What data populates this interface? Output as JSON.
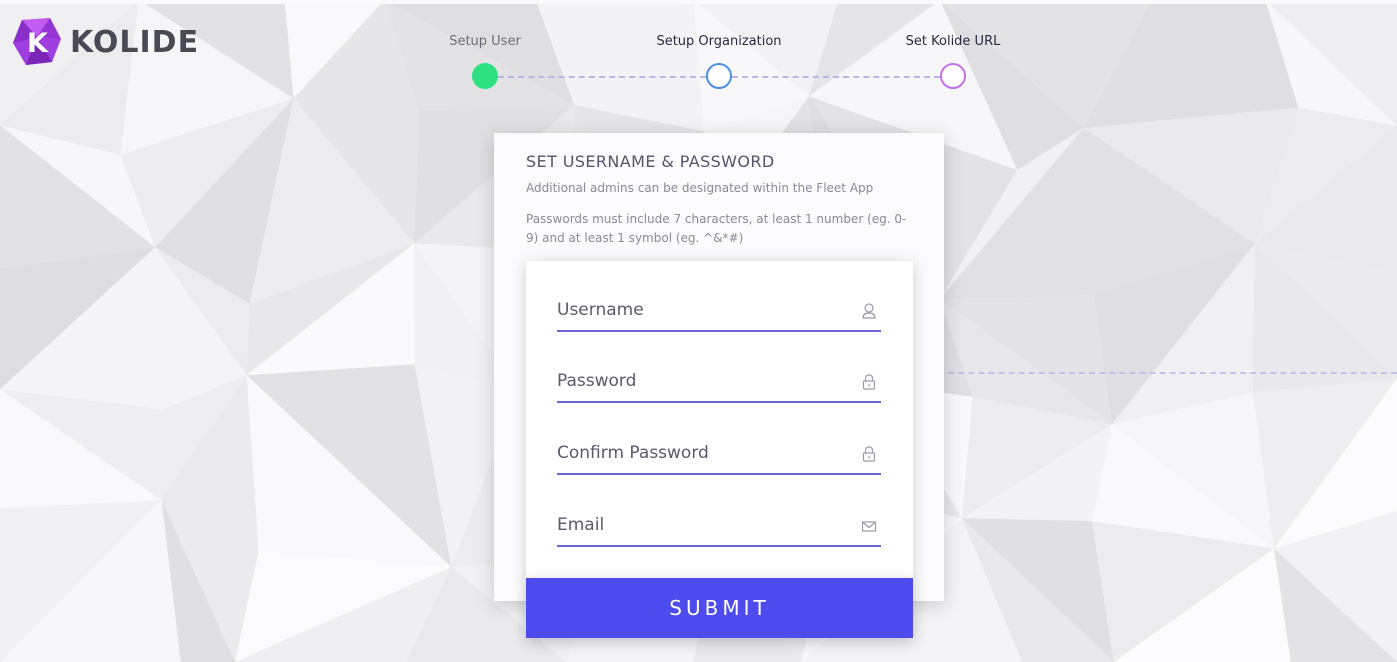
{
  "brand": {
    "name": "KOLIDE",
    "logo_letter": "K"
  },
  "steps": [
    {
      "label": "Setup User",
      "state": "complete",
      "color": "#2fe082"
    },
    {
      "label": "Setup Organization",
      "state": "active",
      "color": "#4a90e2"
    },
    {
      "label": "Set Kolide URL",
      "state": "pending",
      "color": "#c370ec"
    }
  ],
  "card": {
    "title": "SET USERNAME & PASSWORD",
    "subtitle": "Additional admins can be designated within the Fleet App",
    "note": "Passwords must include 7 characters, at least 1 number (eg. 0-9) and at least 1 symbol (eg. ^&*#)"
  },
  "form": {
    "username": {
      "placeholder": "Username",
      "value": "",
      "icon": "user-icon"
    },
    "password": {
      "placeholder": "Password",
      "value": "",
      "icon": "lock-icon"
    },
    "confirm_password": {
      "placeholder": "Confirm Password",
      "value": "",
      "icon": "lock-icon"
    },
    "email": {
      "placeholder": "Email",
      "value": "",
      "icon": "envelope-icon"
    },
    "submit_label": "SUBMIT"
  },
  "colors": {
    "accent": "#4e4cee",
    "field_underline": "#6b68d6",
    "brand_purple": "#9b3fd6"
  }
}
